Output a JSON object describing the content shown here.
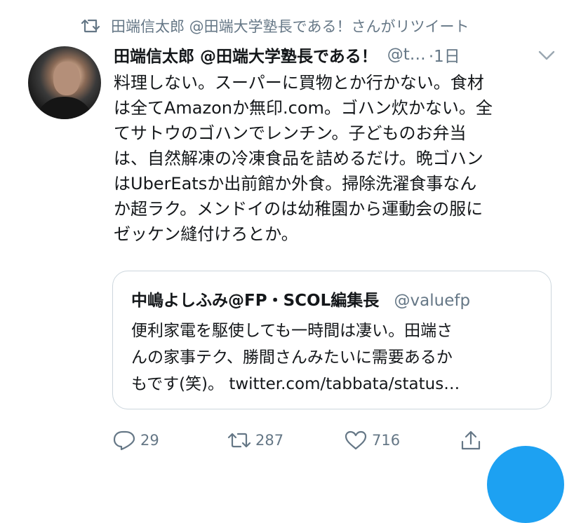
{
  "retweet_banner": {
    "text": "田端信太郎 @田端大学塾長である！さんがリツイート",
    "icon": "retweet-icon"
  },
  "tweet": {
    "author_name": "田端信太郎 @田端大学塾長である！",
    "handle": "@t…",
    "time": "·1日",
    "avatar": "avatar-photo",
    "body_lines": [
      "料理しない。スーパーに買物とか行かない。食材",
      "は全てAmazonか無印.com。ゴハン炊かない。全",
      "てサトウのゴハンでレンチン。子どものお弁当",
      "は、自然解凍の冷凍食品を詰めるだけ。晩ゴハン",
      "はUberEatsか出前館か外食。掃除洗濯食事なん",
      "か超ラク。メンドイのは幼稚園から運動会の服に",
      "ゼッケン縫付けろとか。"
    ]
  },
  "quoted_tweet": {
    "author_name": "中嶋よしふみ@FP・SCOL編集長",
    "handle": "@valuefp",
    "body_lines": [
      "便利家電を駆使しても一時間は凄い。田端さ",
      "んの家事テク、勝間さんみたいに需要あるか",
      "もです(笑)。 twitter.com/tabbata/status…"
    ]
  },
  "actions": {
    "reply": {
      "icon": "reply-icon",
      "count": "29"
    },
    "retweet": {
      "icon": "retweet-icon",
      "count": "287"
    },
    "like": {
      "icon": "heart-icon",
      "count": "716"
    },
    "share": {
      "icon": "share-icon"
    }
  },
  "colors": {
    "accent": "#1da1f2",
    "muted": "#657786",
    "text": "#14171a",
    "border": "#ccd6dd"
  }
}
